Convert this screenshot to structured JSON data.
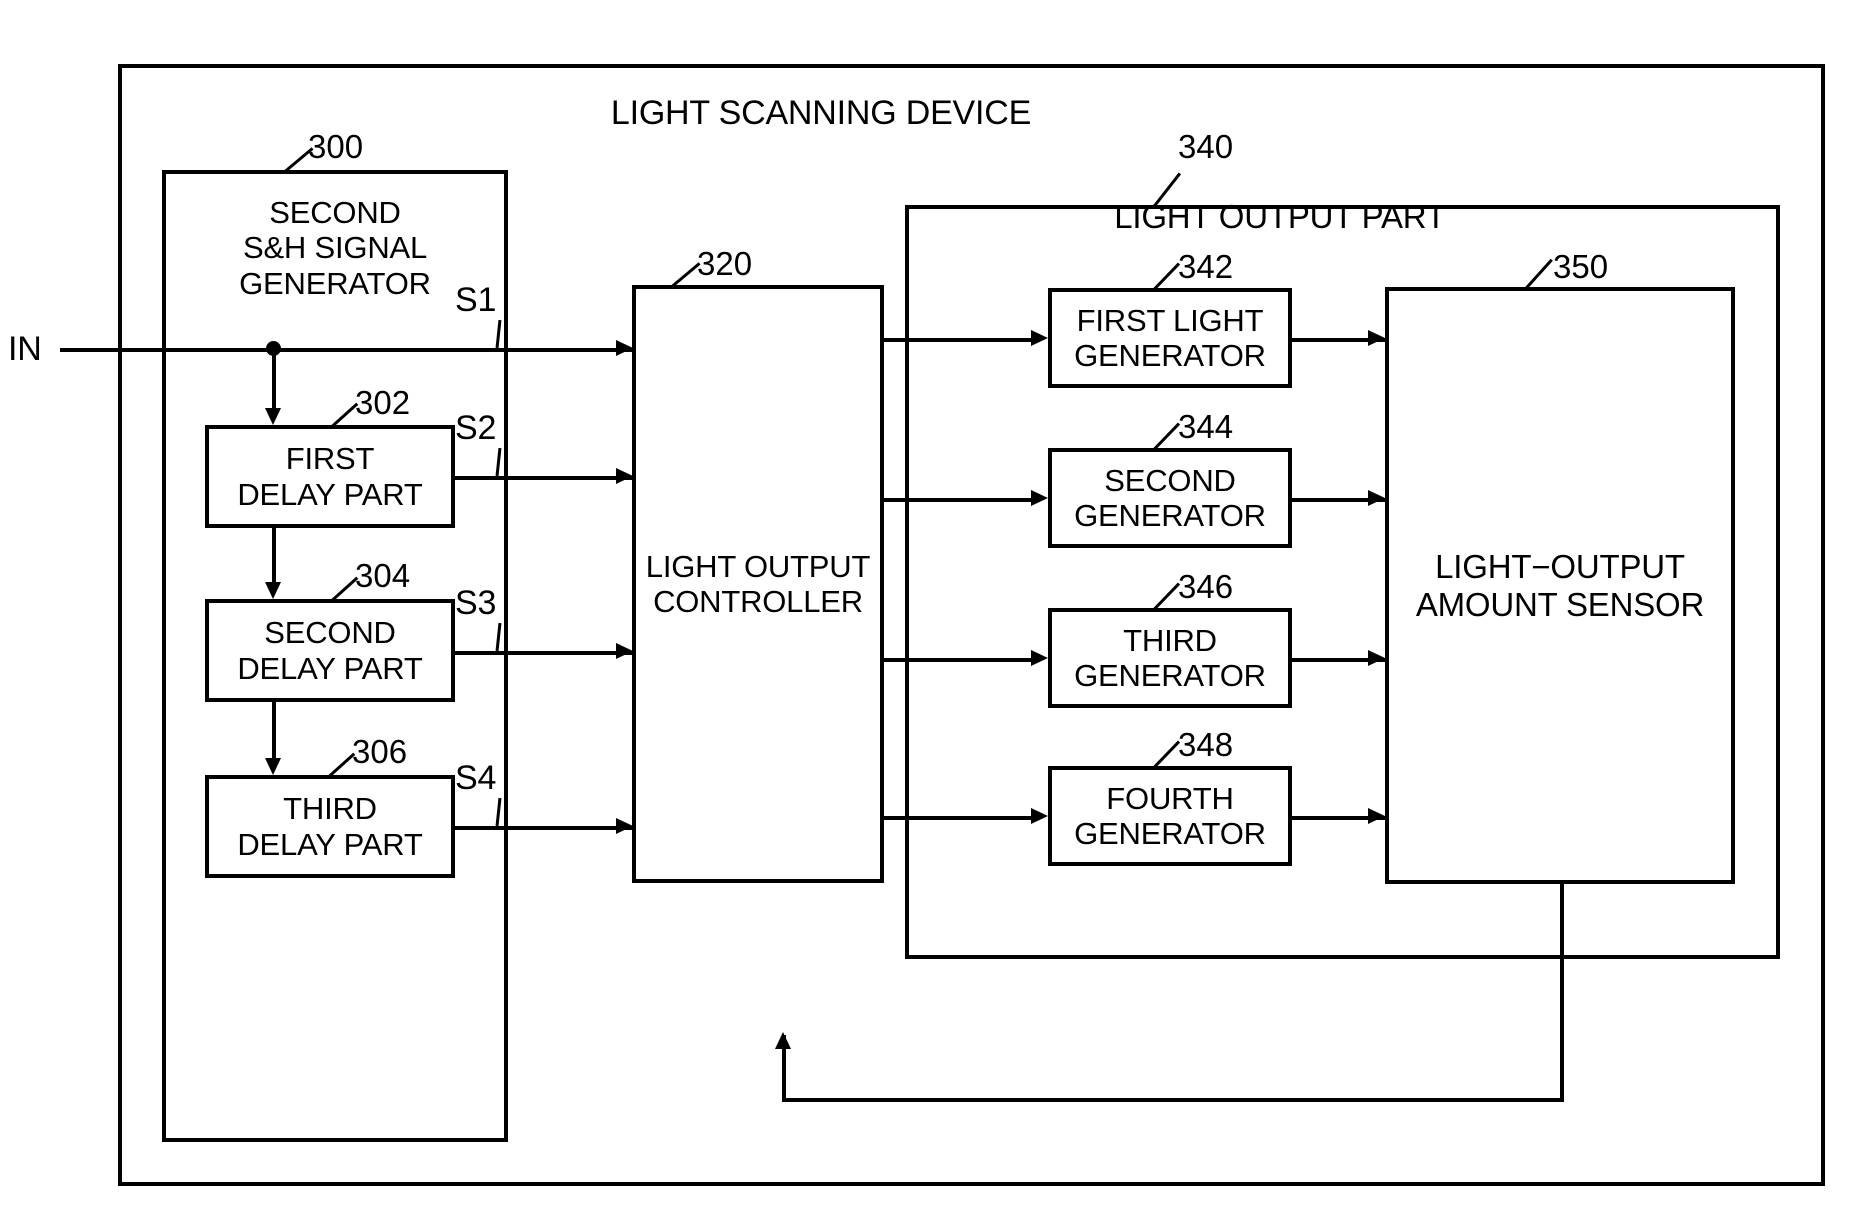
{
  "diagram": {
    "title": "LIGHT SCANNING DEVICE",
    "input_label": "IN"
  },
  "blocks": {
    "sh_generator": {
      "ref": "300",
      "label": "SECOND\nS&H SIGNAL\nGENERATOR"
    },
    "first_delay": {
      "ref": "302",
      "label": "FIRST\nDELAY PART"
    },
    "second_delay": {
      "ref": "304",
      "label": "SECOND\nDELAY PART"
    },
    "third_delay": {
      "ref": "306",
      "label": "THIRD\nDELAY PART"
    },
    "controller": {
      "ref": "320",
      "label": "LIGHT OUTPUT\nCONTROLLER"
    },
    "light_output_part": {
      "ref": "340",
      "label": "LIGHT OUTPUT PART"
    },
    "first_generator": {
      "ref": "342",
      "label": "FIRST LIGHT\nGENERATOR"
    },
    "second_generator": {
      "ref": "344",
      "label": "SECOND\nGENERATOR"
    },
    "third_generator": {
      "ref": "346",
      "label": "THIRD\nGENERATOR"
    },
    "fourth_generator": {
      "ref": "348",
      "label": "FOURTH\nGENERATOR"
    },
    "amount_sensor": {
      "ref": "350",
      "label": "LIGHT−OUTPUT\nAMOUNT SENSOR"
    }
  },
  "signals": {
    "s1": "S1",
    "s2": "S2",
    "s3": "S3",
    "s4": "S4"
  },
  "colors": {
    "line": "#000000",
    "background": "#ffffff"
  }
}
